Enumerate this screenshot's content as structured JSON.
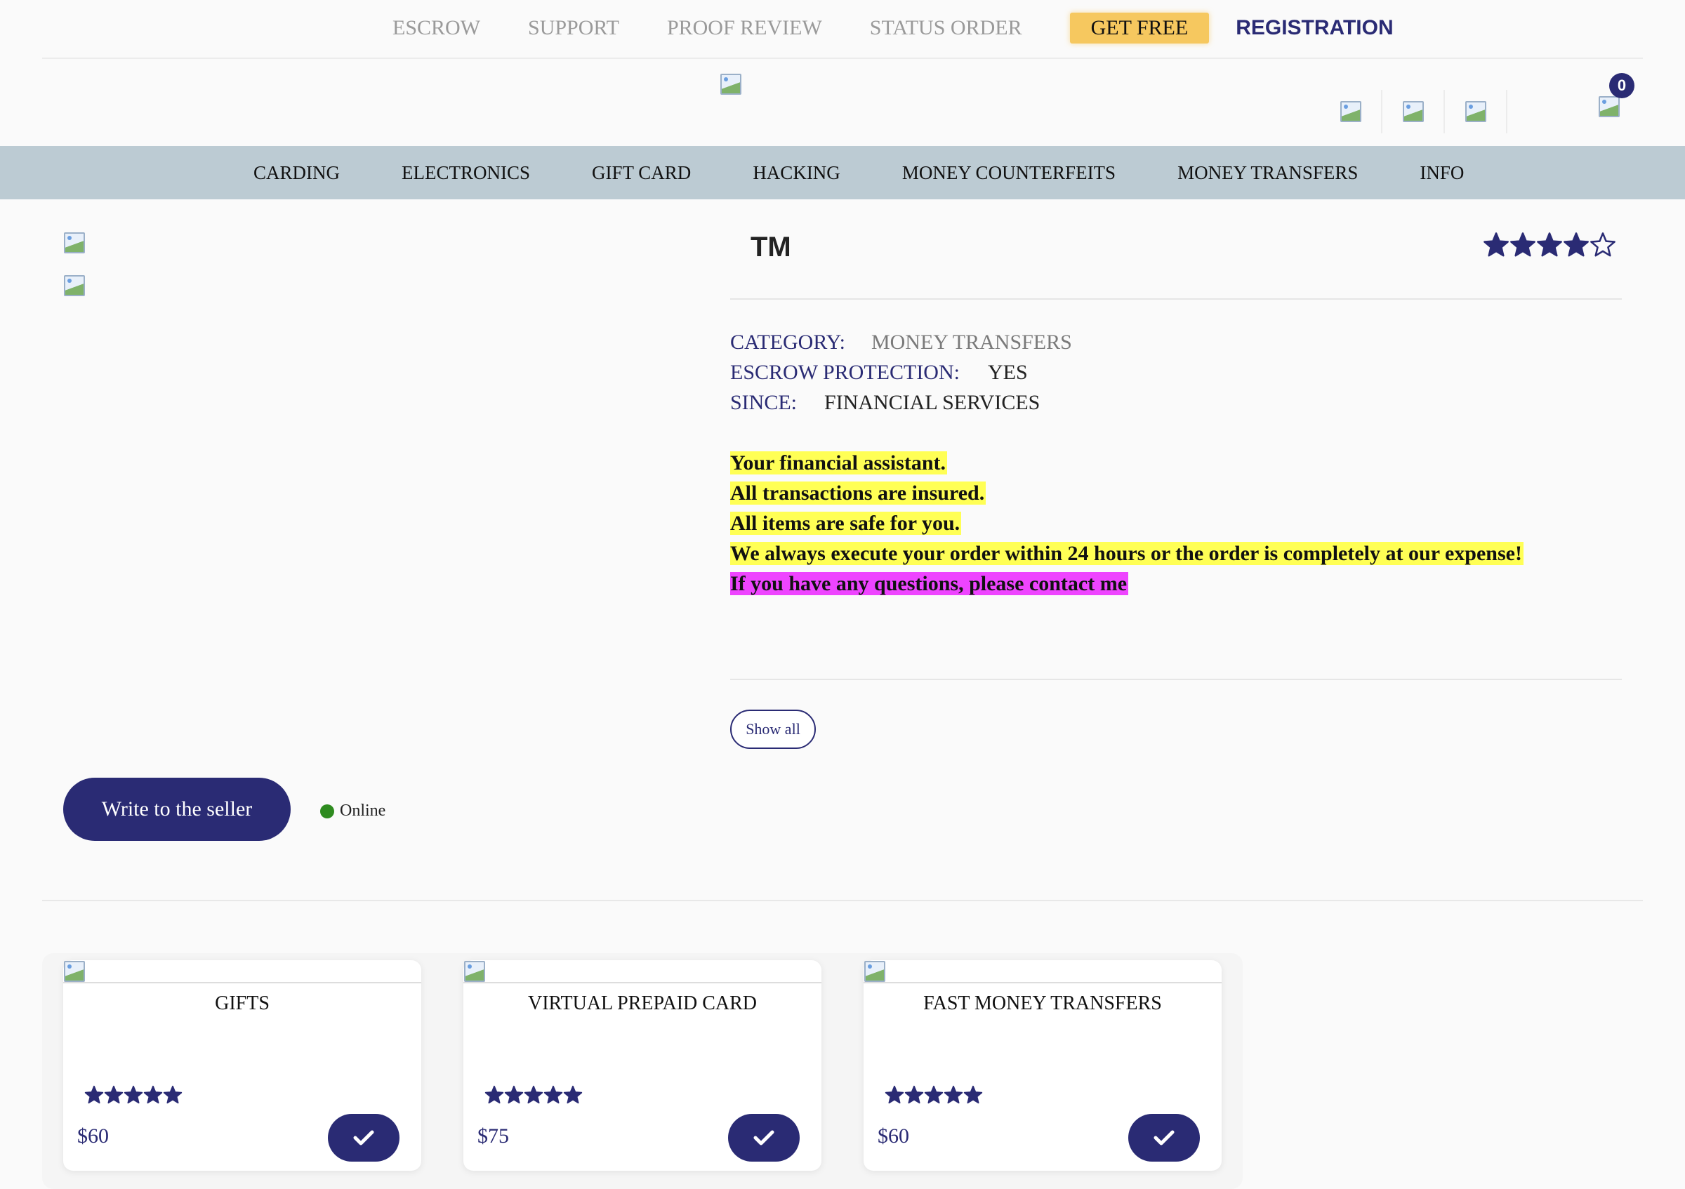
{
  "topnav": {
    "links": [
      "ESCROW",
      "SUPPORT",
      "PROOF REVIEW",
      "STATUS ORDER"
    ],
    "get_free": "GET FREE",
    "registration": "REGISTRATION"
  },
  "header": {
    "cart_count": "0"
  },
  "categories": [
    "CARDING",
    "ELECTRONICS",
    "GIFT CARD",
    "HACKING",
    "MONEY COUNTERFEITS",
    "MONEY TRANSFERS",
    "INFO"
  ],
  "product": {
    "title": "TM",
    "rating": 4,
    "rating_max": 5,
    "meta": {
      "category_label": "CATEGORY:",
      "category_value": "MONEY TRANSFERS",
      "escrow_label": "ESCROW PROTECTION:",
      "escrow_value": "YES",
      "since_label": "SINCE:",
      "since_value": "FINANCIAL SERVICES"
    },
    "description": [
      "Your financial assistant.",
      "All transactions are insured.",
      "All items are safe for you.",
      "We always execute your order within 24 hours or the order is completely at our expense!",
      "If you have any questions, please contact me"
    ],
    "show_all": "Show all"
  },
  "seller": {
    "write_button": "Write to the seller",
    "status": "Online"
  },
  "cards": [
    {
      "name": "GIFTS",
      "price": "$60",
      "rating": 5
    },
    {
      "name": "VIRTUAL PREPAID CARD",
      "price": "$75",
      "rating": 5
    },
    {
      "name": "FAST MONEY TRANSFERS",
      "price": "$60",
      "rating": 5
    }
  ],
  "colors": {
    "brand": "#2a2b74",
    "nav_bg": "#bccbd3",
    "get_free_bg": "#f6c85f",
    "highlight_yellow": "#ffff55",
    "highlight_magenta": "#ee44ff",
    "online_green": "#2e8b1f"
  }
}
